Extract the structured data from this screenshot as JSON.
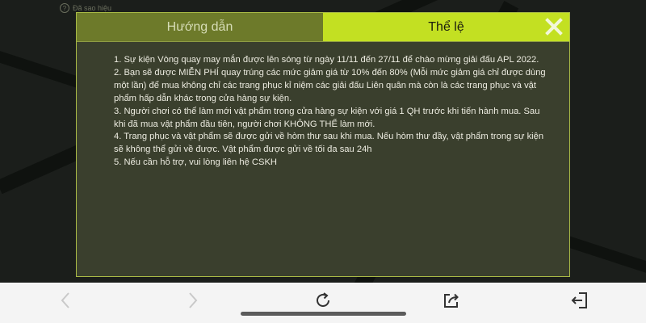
{
  "top_hint": {
    "text": "Đã sao hiệu"
  },
  "tabs": [
    {
      "label": "Hướng dẫn",
      "active": false
    },
    {
      "label": "Thể lệ",
      "active": true
    }
  ],
  "rules": [
    "1. Sự kiện Vòng quay may mắn được lên sóng từ ngày 11/11 đến 27/11 để chào mừng giải đấu APL 2022.",
    "2. Bạn sẽ được MIỄN PHÍ quay trúng các mức giảm giá từ 10% đến 80% (Mỗi mức giảm giá chỉ được dùng một lần) để mua không chỉ các trang phục kỉ niệm các giải đấu Liên quân mà còn là các trang phục và vật phẩm hấp dẫn khác trong cửa hàng sự kiện.",
    "3. Người chơi có thể làm mới vật phẩm trong cửa hàng sự kiện với giá 1 QH trước khi tiến hành mua. Sau khi đã mua vật phẩm đầu tiên, người chơi KHÔNG THỂ làm mới.",
    "4. Trang phục và vật phẩm sẽ được gửi về hòm thư sau khi mua. Nếu hòm thư đầy, vật phẩm trong sự kiện sẽ không thể gửi về được. Vật phẩm được gửi về tối đa sau 24h",
    "5. Nếu cần hỗ trợ, vui lòng liên hệ CSKH"
  ],
  "icons": {
    "close": "close-icon",
    "back": "chevron-left-icon",
    "forward": "chevron-right-icon",
    "reload": "reload-icon",
    "share": "share-icon",
    "exit": "exit-icon"
  },
  "colors": {
    "accent": "#c3e022",
    "tab_inactive": "#6d7a2a",
    "panel": "#3a3f2d",
    "border": "#a9ba46"
  }
}
